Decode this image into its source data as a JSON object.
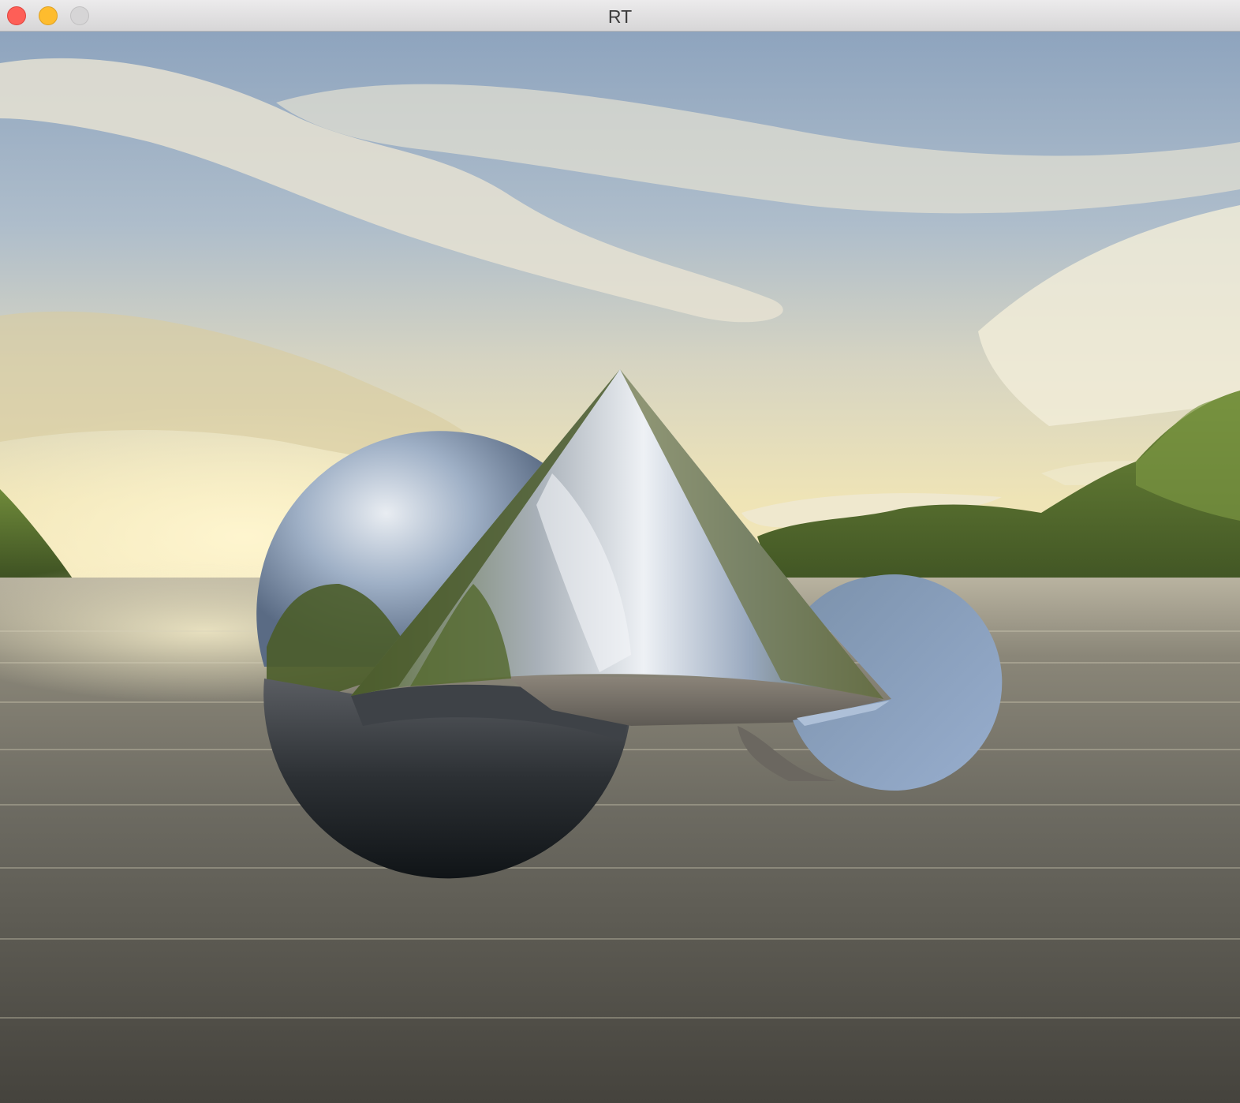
{
  "window": {
    "title": "RT",
    "controls": {
      "close_color": "#fe5f57",
      "minimize_color": "#febc2e",
      "zoom_color": "#d6d5d6"
    }
  },
  "scene": {
    "objects": [
      "reflective-sphere",
      "reflective-cone",
      "sliced-sphere-disk"
    ],
    "environment": [
      "sky",
      "clouds",
      "mountains",
      "sea"
    ]
  }
}
